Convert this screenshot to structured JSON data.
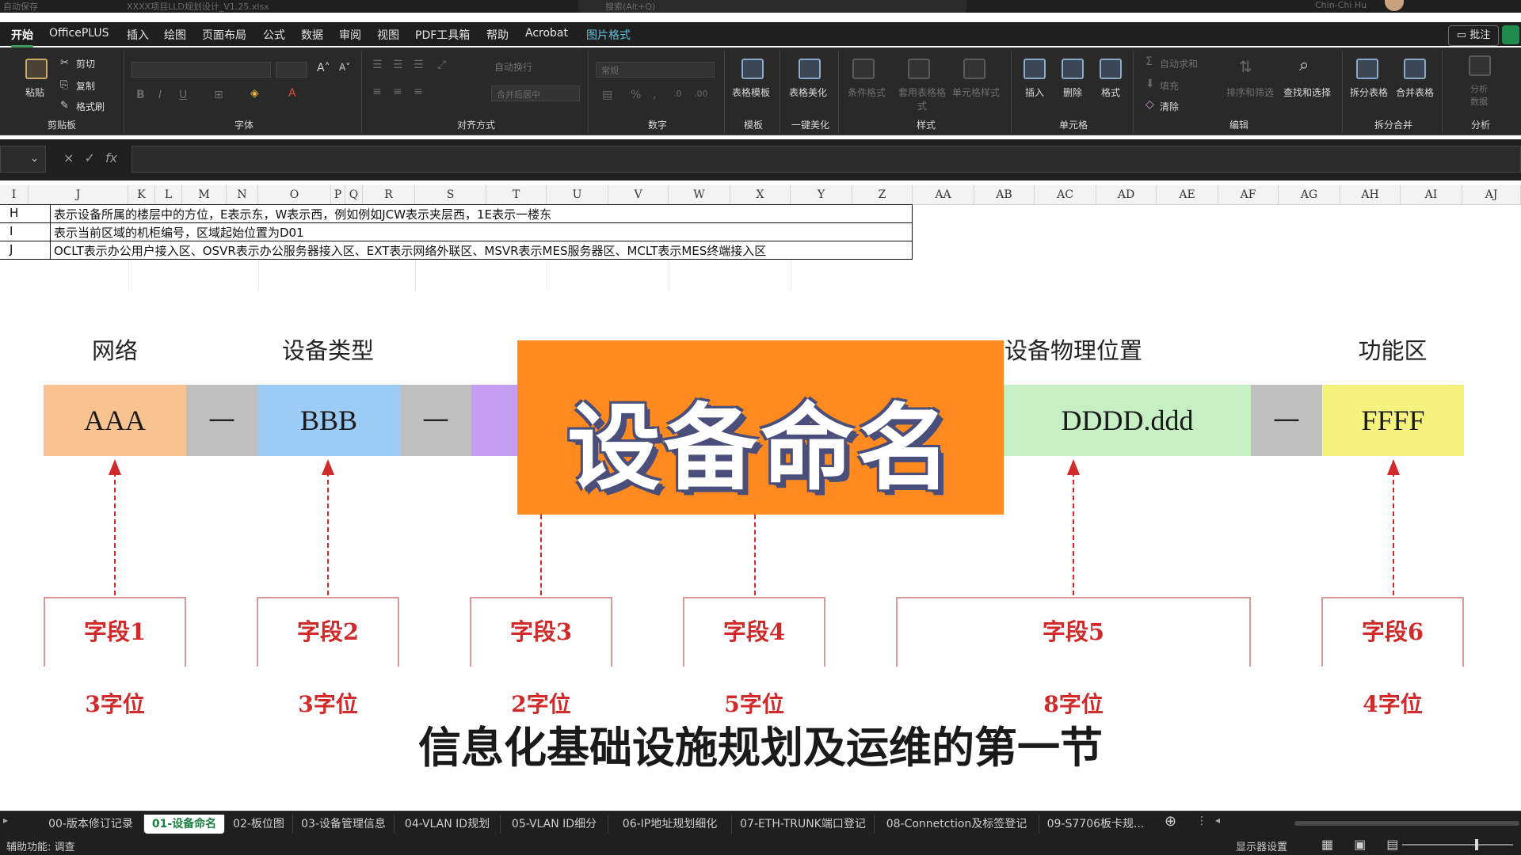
{
  "titlebar": {
    "autosave": "自动保存",
    "filename": "XXXX项目LLD规划设计_V1.25.xlsx",
    "search_placeholder": "搜索(Alt+Q)",
    "username": "Chin-Chi Hu"
  },
  "menu": {
    "tabs": [
      "开始",
      "OfficePLUS",
      "插入",
      "绘图",
      "页面布局",
      "公式",
      "数据",
      "审阅",
      "视图",
      "PDF工具箱",
      "帮助",
      "Acrobat",
      "图片格式"
    ],
    "active": "开始",
    "comments_label": "批注"
  },
  "ribbon": {
    "clipboard": {
      "paste": "粘贴",
      "cut": "剪切",
      "copy": "复制",
      "format_painter": "格式刷",
      "label": "剪贴板"
    },
    "font": {
      "label": "字体",
      "bold": "B",
      "italic": "I",
      "underline": "U"
    },
    "alignment": {
      "wrap": "自动换行",
      "merge": "合并后居中",
      "label": "对齐方式"
    },
    "number": {
      "format": "常规",
      "label": "数字"
    },
    "template": {
      "table_template": "表格模板",
      "label": "模板"
    },
    "beautify": {
      "table_beautify": "表格美化",
      "label": "一键美化"
    },
    "styles": {
      "conditional": "条件格式",
      "table_style": "套用表格格式",
      "cell_style": "单元格样式",
      "label": "样式"
    },
    "cells": {
      "insert": "插入",
      "delete": "删除",
      "format": "格式",
      "label": "单元格"
    },
    "editing": {
      "autosum": "自动求和",
      "fill": "填充",
      "clear": "清除",
      "sort_filter": "排序和筛选",
      "find_select": "查找和选择",
      "label": "编辑"
    },
    "split_merge": {
      "split": "拆分表格",
      "merge": "合并表格",
      "label": "拆分合并"
    },
    "analysis": {
      "analyze": "分析数据",
      "label": "分析"
    }
  },
  "formula_bar": {
    "fx": "fx",
    "cancel": "×",
    "confirm": "✓"
  },
  "columns": [
    "I",
    "J",
    "K",
    "L",
    "M",
    "N",
    "O",
    "P",
    "Q",
    "R",
    "S",
    "T",
    "U",
    "V",
    "W",
    "X",
    "Y",
    "Z",
    "AA",
    "AB",
    "AC",
    "AD",
    "AE",
    "AF",
    "AG",
    "AH",
    "AI",
    "AJ"
  ],
  "rows": [
    {
      "id": "H",
      "text": "表示设备所属的楼层中的方位，E表示东，W表示西，例如例如JCW表示夹层西，1E表示一楼东"
    },
    {
      "id": "I",
      "text": "表示当前区域的机柜编号，区域起始位置为D01"
    },
    {
      "id": "J",
      "text": "OCLT表示办公用户接入区、OSVR表示办公服务器接入区、EXT表示网络外联区、MSVR表示MES服务器区、MCLT表示MES终端接入区"
    }
  ],
  "diagram": {
    "segments": [
      {
        "label": "网络",
        "code": "AAA",
        "color": "#f8c391"
      },
      {
        "label": "设备类型",
        "code": "BBB",
        "color": "#9ccbf5"
      },
      {
        "label": "",
        "code": "",
        "color": "#c49cf2"
      },
      {
        "label": "设备物理位置",
        "code": "DDDD.ddd",
        "color": "#c6f0c4"
      },
      {
        "label": "功能区",
        "code": "FFFF",
        "color": "#f6f27e"
      }
    ],
    "separator": "—",
    "fields": [
      {
        "name": "字段1",
        "digits": "3字位"
      },
      {
        "name": "字段2",
        "digits": "3字位"
      },
      {
        "name": "字段3",
        "digits": "2字位"
      },
      {
        "name": "字段4",
        "digits": "5字位"
      },
      {
        "name": "字段5",
        "digits": "8字位"
      },
      {
        "name": "字段6",
        "digits": "4字位"
      }
    ]
  },
  "overlay": {
    "title": "设备命名",
    "bg_color": "#ff8a1f"
  },
  "subtitle": "信息化基础设施规划及运维的第一节",
  "sheets": [
    "00-版本修订记录",
    "01-设备命名",
    "02-板位图",
    "03-设备管理信息",
    "04-VLAN ID规划",
    "05-VLAN ID细分",
    "06-IP地址规划细化",
    "07-ETH-TRUNK端口登记",
    "08-Connetction及标签登记",
    "09-S7706板卡规..."
  ],
  "active_sheet": "01-设备命名",
  "status": {
    "accessibility": "辅助功能: 调查",
    "display_settings": "显示器设置"
  }
}
